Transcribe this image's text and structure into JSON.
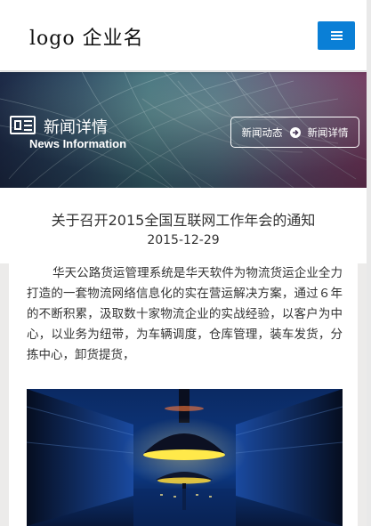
{
  "header": {
    "logo_text": "logo 企业名",
    "menu_icon": "hamburger-menu-icon",
    "accent_color": "#0a7fd6"
  },
  "banner": {
    "icon": "newspaper-icon",
    "title": "新闻详情",
    "subtitle": "News Information",
    "breadcrumb": {
      "parent": "新闻动态",
      "separator_icon": "arrow-right-circle-icon",
      "current": "新闻详情"
    }
  },
  "article": {
    "title": "关于召开2015全国互联网工作年会的通知",
    "date": "2015-12-29",
    "body": "华天公路货运管理系统是华天软件为物流货运企业全力打造的一套物流网络信息化的实在营运解决方案，通过６年的不断积累，汲取数十家物流企业的实战经验，以客户为中心，以业务为纽带，为车辆调度，仓库管理，装车发货，分拣中心，卸货提货，",
    "image": "subway-station-photo"
  }
}
